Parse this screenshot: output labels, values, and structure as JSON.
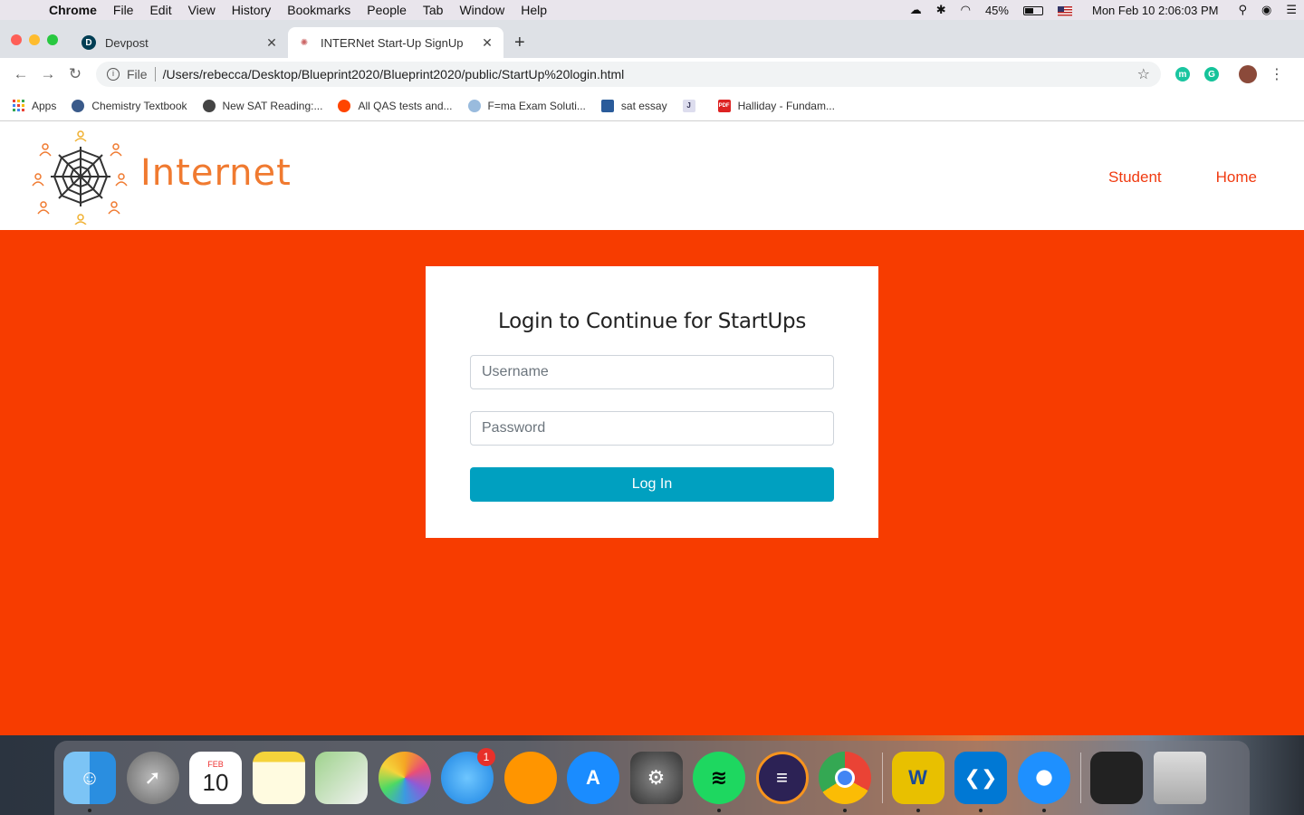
{
  "menubar": {
    "app": "Chrome",
    "items": [
      "File",
      "Edit",
      "View",
      "History",
      "Bookmarks",
      "People",
      "Tab",
      "Window",
      "Help"
    ],
    "battery": "45%",
    "clock": "Mon Feb 10  2:06:03 PM"
  },
  "tabs": [
    {
      "title": "Devpost",
      "favicon": "D"
    },
    {
      "title": "INTERNet Start-Up SignUp"
    }
  ],
  "toolbar": {
    "scheme": "File",
    "url": "/Users/rebecca/Desktop/Blueprint2020/Blueprint2020/public/StartUp%20login.html",
    "ext1": "m"
  },
  "bookmarks": [
    {
      "label": "Apps"
    },
    {
      "label": "Chemistry Textbook"
    },
    {
      "label": "New SAT Reading:..."
    },
    {
      "label": "All QAS tests and..."
    },
    {
      "label": "F=ma Exam Soluti..."
    },
    {
      "label": "sat essay"
    },
    {
      "label": "",
      "glyph": "J"
    },
    {
      "label": "Halliday - Fundam...",
      "glyph": "PDF"
    }
  ],
  "site": {
    "brand": "Internet",
    "nav": [
      "Student",
      "Home"
    ],
    "login": {
      "heading": "Login to Continue for StartUps",
      "username_placeholder": "Username",
      "password_placeholder": "Password",
      "button": "Log In"
    }
  },
  "dock": {
    "calendar_month": "FEB",
    "calendar_day": "10",
    "messages_badge": "1"
  },
  "colors": {
    "hero": "#f73c00",
    "nav": "#f03a10",
    "brand": "#f07a30",
    "button": "#00a0c0"
  }
}
